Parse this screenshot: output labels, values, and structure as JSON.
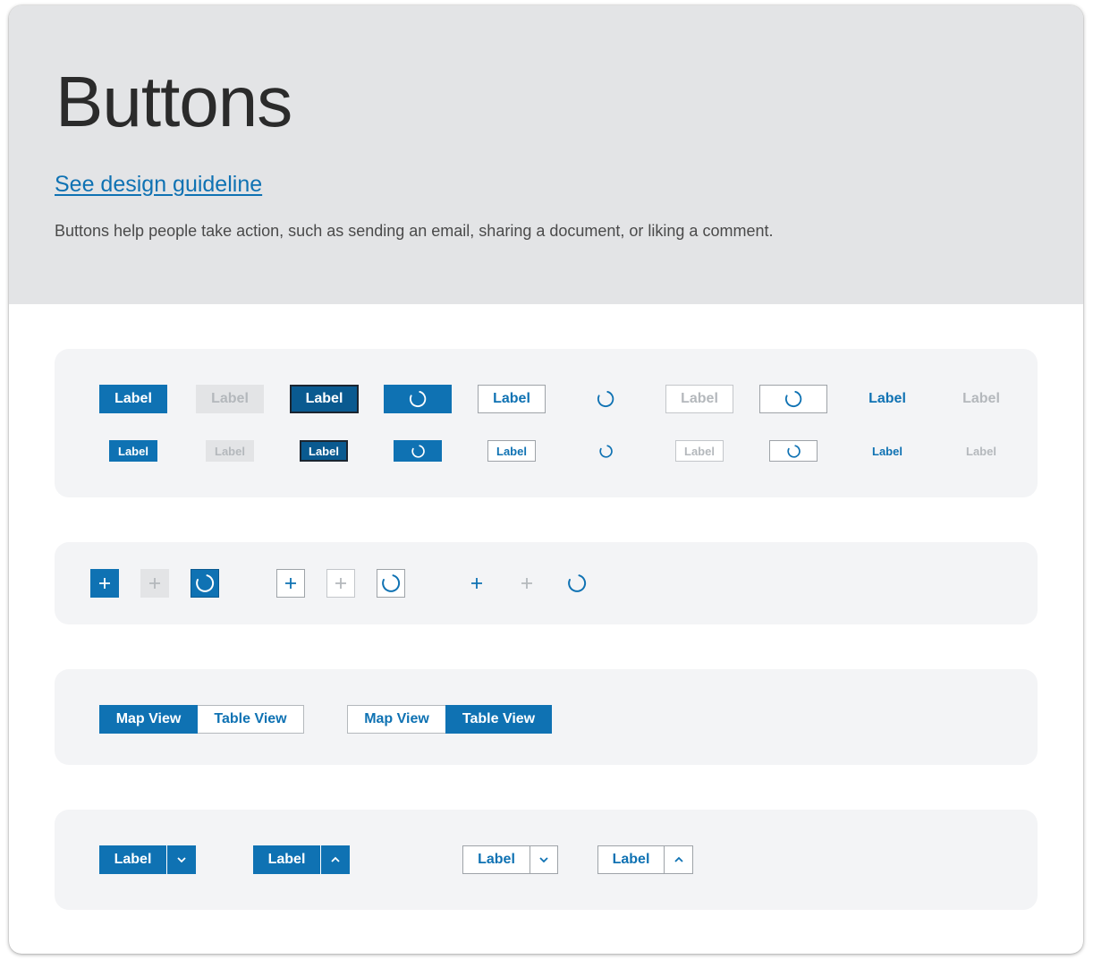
{
  "hero": {
    "title": "Buttons",
    "guideline_link": "See design guideline",
    "description": "Buttons help people take action, such as sending an email, sharing a document, or liking a comment."
  },
  "text_buttons": {
    "label": "Label",
    "variants": [
      "primary",
      "disabled",
      "focused",
      "loading",
      "outline",
      "loading-ghost",
      "outline-disabled",
      "outline-loading",
      "ghost",
      "ghost-disabled"
    ]
  },
  "icon_buttons": {
    "icon": "plus-icon",
    "loading_icon": "spinner-icon"
  },
  "segmented": {
    "first": {
      "left": "Map View",
      "right": "Table View",
      "selected": "Map View"
    },
    "second": {
      "left": "Map View",
      "right": "Table View",
      "selected": "Table View"
    }
  },
  "split_buttons": {
    "label": "Label",
    "down_icon": "chevron-down-icon",
    "up_icon": "chevron-up-icon"
  },
  "colors": {
    "accent": "#0f72b3",
    "accent_dark": "#0a5a90",
    "hero_bg": "#e3e4e6",
    "panel_bg": "#f3f4f6",
    "disabled_text": "#b4b8bc"
  }
}
